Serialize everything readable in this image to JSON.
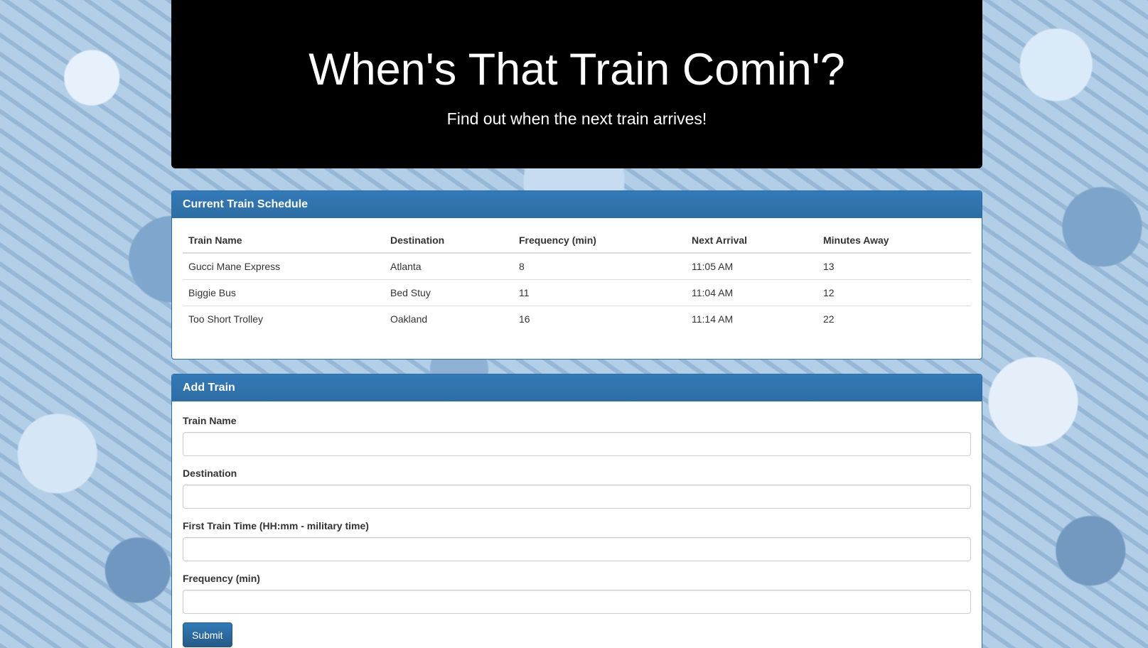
{
  "header": {
    "title": "When's That Train Comin'?",
    "subtitle": "Find out when the next train arrives!"
  },
  "schedule": {
    "panel_title": "Current Train Schedule",
    "columns": [
      "Train Name",
      "Destination",
      "Frequency (min)",
      "Next Arrival",
      "Minutes Away"
    ],
    "rows": [
      [
        "Gucci Mane Express",
        "Atlanta",
        "8",
        "11:05 AM",
        "13"
      ],
      [
        "Biggie Bus",
        "Bed Stuy",
        "11",
        "11:04 AM",
        "12"
      ],
      [
        "Too Short Trolley",
        "Oakland",
        "16",
        "11:14 AM",
        "22"
      ]
    ]
  },
  "add_train": {
    "panel_title": "Add Train",
    "fields": [
      {
        "label": "Train Name",
        "value": ""
      },
      {
        "label": "Destination",
        "value": ""
      },
      {
        "label": "First Train Time (HH:mm - military time)",
        "value": ""
      },
      {
        "label": "Frequency (min)",
        "value": ""
      }
    ],
    "submit_label": "Submit"
  },
  "colors": {
    "panel_accent": "#337ab7",
    "jumbotron_bg": "#000000",
    "background": "#a9c7e4"
  }
}
